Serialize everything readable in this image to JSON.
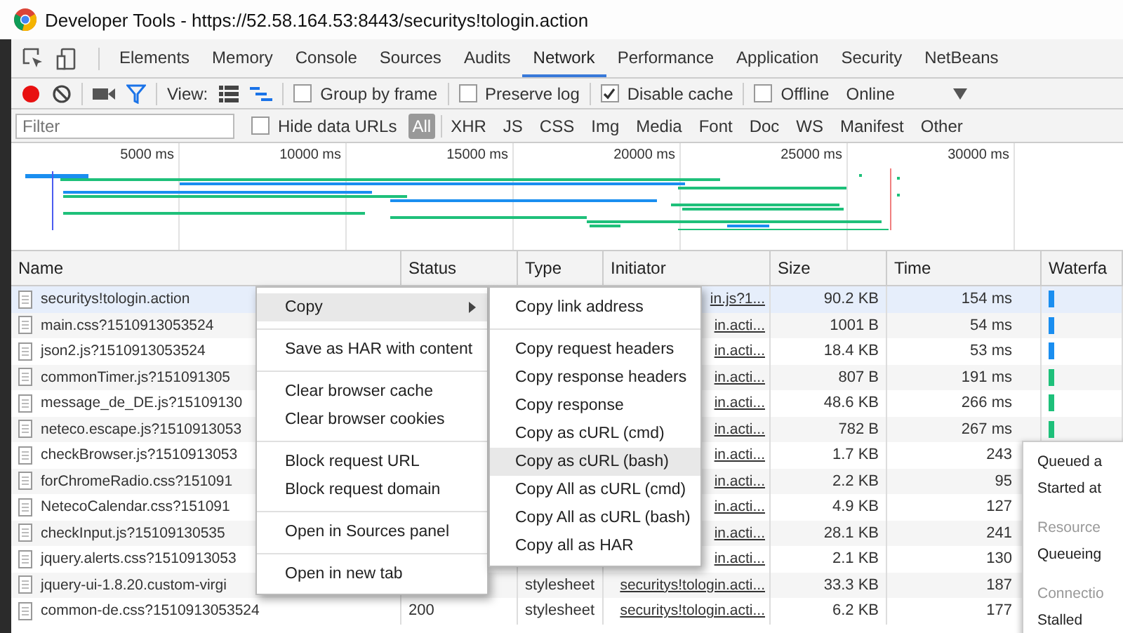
{
  "window": {
    "title": "Developer Tools - https://52.58.164.53:8443/securitys!tologin.action"
  },
  "tabs": [
    {
      "label": "Elements",
      "selected": false
    },
    {
      "label": "Memory",
      "selected": false
    },
    {
      "label": "Console",
      "selected": false
    },
    {
      "label": "Sources",
      "selected": false
    },
    {
      "label": "Audits",
      "selected": false
    },
    {
      "label": "Network",
      "selected": true
    },
    {
      "label": "Performance",
      "selected": false
    },
    {
      "label": "Application",
      "selected": false
    },
    {
      "label": "Security",
      "selected": false
    },
    {
      "label": "NetBeans",
      "selected": false
    }
  ],
  "toolbar": {
    "recording": true,
    "filter_on": true,
    "view_label": "View:",
    "large_rows": false,
    "overview": true,
    "checkboxes": [
      {
        "label": "Group by frame",
        "checked": false
      },
      {
        "label": "Preserve log",
        "checked": false
      },
      {
        "label": "Disable cache",
        "checked": true
      },
      {
        "label": "Offline",
        "checked": false
      }
    ],
    "throttle": "Online"
  },
  "filter_bar": {
    "placeholder": "Filter",
    "hide_data_urls": {
      "label": "Hide data URLs",
      "checked": false
    },
    "types": [
      {
        "label": "All",
        "selected": true
      },
      {
        "label": "XHR",
        "selected": false
      },
      {
        "label": "JS",
        "selected": false
      },
      {
        "label": "CSS",
        "selected": false
      },
      {
        "label": "Img",
        "selected": false
      },
      {
        "label": "Media",
        "selected": false
      },
      {
        "label": "Font",
        "selected": false
      },
      {
        "label": "Doc",
        "selected": false
      },
      {
        "label": "WS",
        "selected": false
      },
      {
        "label": "Manifest",
        "selected": false
      },
      {
        "label": "Other",
        "selected": false
      }
    ]
  },
  "overview": {
    "ticks": [
      "5000 ms",
      "10000 ms",
      "15000 ms",
      "20000 ms",
      "25000 ms",
      "30000 ms"
    ]
  },
  "table": {
    "columns": [
      "Name",
      "Status",
      "Type",
      "Initiator",
      "Size",
      "Time",
      "Waterfa"
    ],
    "rows": [
      {
        "name": "securitys!tologin.action",
        "initiator": "in.js?1...",
        "size": "90.2 KB",
        "time": "154 ms",
        "color": "#1a8ef0",
        "selected": true
      },
      {
        "name": "main.css?1510913053524",
        "initiator": "in.acti...",
        "size": "1001 B",
        "time": "54 ms",
        "color": "#1a8ef0",
        "selected": false
      },
      {
        "name": "json2.js?1510913053524",
        "initiator": "in.acti...",
        "size": "18.4 KB",
        "time": "53 ms",
        "color": "#1a8ef0",
        "selected": false
      },
      {
        "name": "commonTimer.js?151091305",
        "initiator": "in.acti...",
        "size": "807 B",
        "time": "191 ms",
        "color": "#1ec07a",
        "selected": false
      },
      {
        "name": "message_de_DE.js?15109130",
        "initiator": "in.acti...",
        "size": "48.6 KB",
        "time": "266 ms",
        "color": "#1ec07a",
        "selected": false
      },
      {
        "name": "neteco.escape.js?1510913053",
        "initiator": "in.acti...",
        "size": "782 B",
        "time": "267 ms",
        "color": "#1ec07a",
        "selected": false
      },
      {
        "name": "checkBrowser.js?1510913053",
        "initiator": "in.acti...",
        "size": "1.7 KB",
        "time": "243",
        "selected": false
      },
      {
        "name": "forChromeRadio.css?151091",
        "initiator": "in.acti...",
        "size": "2.2 KB",
        "time": "95",
        "selected": false
      },
      {
        "name": "NetecoCalendar.css?151091",
        "initiator": "in.acti...",
        "size": "4.9 KB",
        "time": "127",
        "selected": false
      },
      {
        "name": "checkInput.js?15109130535",
        "initiator": "in.acti...",
        "size": "28.1 KB",
        "time": "241",
        "selected": false
      },
      {
        "name": "jquery.alerts.css?1510913053",
        "initiator": "in.acti...",
        "size": "2.1 KB",
        "time": "130",
        "selected": false
      },
      {
        "name": "jquery-ui-1.8.20.custom-virgi",
        "type": "stylesheet",
        "initiator": "securitys!tologin.acti...",
        "size": "33.3 KB",
        "time": "187",
        "selected": false
      },
      {
        "name": "common-de.css?1510913053524",
        "status": "200",
        "type": "stylesheet",
        "initiator": "securitys!tologin.acti...",
        "size": "6.2 KB",
        "time": "177",
        "selected": false
      }
    ]
  },
  "context_menu": {
    "groups": [
      [
        {
          "label": "Copy",
          "submenu": true,
          "highlighted": true
        }
      ],
      [
        {
          "label": "Save as HAR with content",
          "submenu": false,
          "highlighted": false
        }
      ],
      [
        {
          "label": "Clear browser cache",
          "submenu": false,
          "highlighted": false
        },
        {
          "label": "Clear browser cookies",
          "submenu": false,
          "highlighted": false
        }
      ],
      [
        {
          "label": "Block request URL",
          "submenu": false,
          "highlighted": false
        },
        {
          "label": "Block request domain",
          "submenu": false,
          "highlighted": false
        }
      ],
      [
        {
          "label": "Open in Sources panel",
          "submenu": false,
          "highlighted": false
        }
      ],
      [
        {
          "label": "Open in new tab",
          "submenu": false,
          "highlighted": false
        }
      ]
    ]
  },
  "submenu": {
    "groups": [
      [
        {
          "label": "Copy link address",
          "highlighted": false
        }
      ],
      [
        {
          "label": "Copy request headers",
          "highlighted": false
        },
        {
          "label": "Copy response headers",
          "highlighted": false
        },
        {
          "label": "Copy response",
          "highlighted": false
        },
        {
          "label": "Copy as cURL (cmd)",
          "highlighted": false
        },
        {
          "label": "Copy as cURL (bash)",
          "highlighted": true
        },
        {
          "label": "Copy All as cURL (cmd)",
          "highlighted": false
        },
        {
          "label": "Copy All as cURL (bash)",
          "highlighted": false
        },
        {
          "label": "Copy all as HAR",
          "highlighted": false
        }
      ]
    ]
  },
  "tooltip": {
    "lines": [
      {
        "kind": "line",
        "text": "Queued a"
      },
      {
        "kind": "line",
        "text": "Started at"
      },
      {
        "kind": "section",
        "text": "Resource"
      },
      {
        "kind": "line",
        "text": "Queueing"
      },
      {
        "kind": "section",
        "text": "Connectio"
      },
      {
        "kind": "line",
        "text": "Stalled"
      }
    ]
  }
}
